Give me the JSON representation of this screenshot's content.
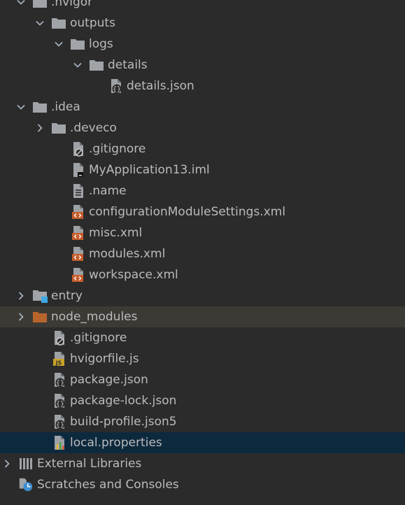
{
  "tree": {
    "items": [
      {
        "label": ".hvigor",
        "depth": 0,
        "expanded": true,
        "icon": "folder-icon"
      },
      {
        "label": "outputs",
        "depth": 1,
        "expanded": true,
        "icon": "folder-icon"
      },
      {
        "label": "logs",
        "depth": 2,
        "expanded": true,
        "icon": "folder-icon"
      },
      {
        "label": "details",
        "depth": 3,
        "expanded": true,
        "icon": "folder-icon"
      },
      {
        "label": "details.json",
        "depth": 4,
        "icon": "json-file-icon"
      },
      {
        "label": ".idea",
        "depth": 0,
        "expanded": true,
        "icon": "folder-icon"
      },
      {
        "label": ".deveco",
        "depth": 1,
        "expanded": false,
        "icon": "folder-icon"
      },
      {
        "label": ".gitignore",
        "depth": 2,
        "icon": "gitignore-file-icon"
      },
      {
        "label": "MyApplication13.iml",
        "depth": 2,
        "icon": "iml-file-icon"
      },
      {
        "label": ".name",
        "depth": 2,
        "icon": "text-file-icon"
      },
      {
        "label": "configurationModuleSettings.xml",
        "depth": 2,
        "icon": "xml-file-icon"
      },
      {
        "label": "misc.xml",
        "depth": 2,
        "icon": "xml-file-icon"
      },
      {
        "label": "modules.xml",
        "depth": 2,
        "icon": "xml-file-icon"
      },
      {
        "label": "workspace.xml",
        "depth": 2,
        "icon": "xml-file-icon"
      },
      {
        "label": "entry",
        "depth": 0,
        "expanded": false,
        "icon": "module-folder-icon"
      },
      {
        "label": "node_modules",
        "depth": 0,
        "expanded": false,
        "icon": "excluded-folder-icon",
        "excluded": true
      },
      {
        "label": ".gitignore",
        "depth": 1,
        "icon": "gitignore-file-icon"
      },
      {
        "label": "hvigorfile.js",
        "depth": 1,
        "icon": "js-file-icon"
      },
      {
        "label": "package.json",
        "depth": 1,
        "icon": "json-file-icon"
      },
      {
        "label": "package-lock.json",
        "depth": 1,
        "icon": "json-file-icon"
      },
      {
        "label": "build-profile.json5",
        "depth": 1,
        "icon": "json-file-icon"
      },
      {
        "label": "local.properties",
        "depth": 1,
        "icon": "properties-file-icon",
        "selected": true
      },
      {
        "label": "External Libraries",
        "depth": -1,
        "expanded": false,
        "icon": "libraries-icon"
      },
      {
        "label": "Scratches and Consoles",
        "depth": -1,
        "icon": "scratches-icon"
      }
    ]
  },
  "colors": {
    "background": "#2b2b2b",
    "text": "#bbbbbb",
    "folder": "#a0a4a8",
    "excluded_folder": "#b8652d",
    "selected_row": "#0d293e",
    "excluded_row": "#3c3a35",
    "xml_accent": "#c75d2c",
    "module_accent": "#3ea8e5"
  }
}
